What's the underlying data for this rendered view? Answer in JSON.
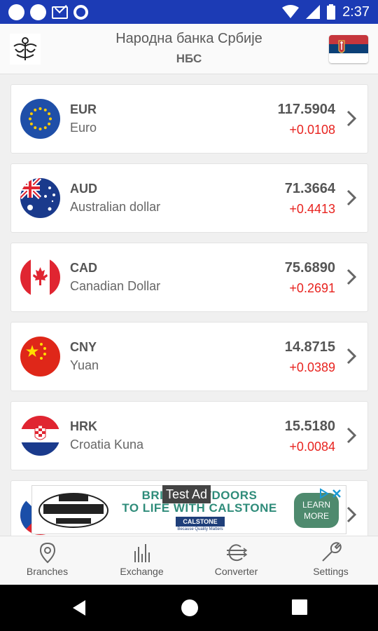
{
  "status_bar": {
    "time": "2:37"
  },
  "header": {
    "title": "Народна банка Србије",
    "subtitle": "НБС"
  },
  "currencies": [
    {
      "code": "EUR",
      "name": "Euro",
      "rate": "117.5904",
      "change": "+0.0108",
      "flag_icon": "eu-flag-icon"
    },
    {
      "code": "AUD",
      "name": "Australian dollar",
      "rate": "71.3664",
      "change": "+0.4413",
      "flag_icon": "australia-flag-icon"
    },
    {
      "code": "CAD",
      "name": "Canadian Dollar",
      "rate": "75.6890",
      "change": "+0.2691",
      "flag_icon": "canada-flag-icon"
    },
    {
      "code": "CNY",
      "name": "Yuan",
      "rate": "14.8715",
      "change": "+0.0389",
      "flag_icon": "china-flag-icon"
    },
    {
      "code": "HRK",
      "name": "Croatia Kuna",
      "rate": "15.5180",
      "change": "+0.0084",
      "flag_icon": "croatia-flag-icon"
    }
  ],
  "ad": {
    "label": "Test Ad",
    "line1": "BRING OUTDOORS",
    "line2": "TO LIFE WITH CALSTONE",
    "brand": "CALSTONE",
    "tagline": "Because Quality Matters",
    "cta_line1": "LEARN",
    "cta_line2": "MORE"
  },
  "bottom_nav": {
    "branches": "Branches",
    "exchange": "Exchange",
    "converter": "Converter",
    "settings": "Settings"
  },
  "colors": {
    "status_bar": "#1c3bb5",
    "change_positive": "#e8231f",
    "ad_text": "#2f8c7a"
  }
}
